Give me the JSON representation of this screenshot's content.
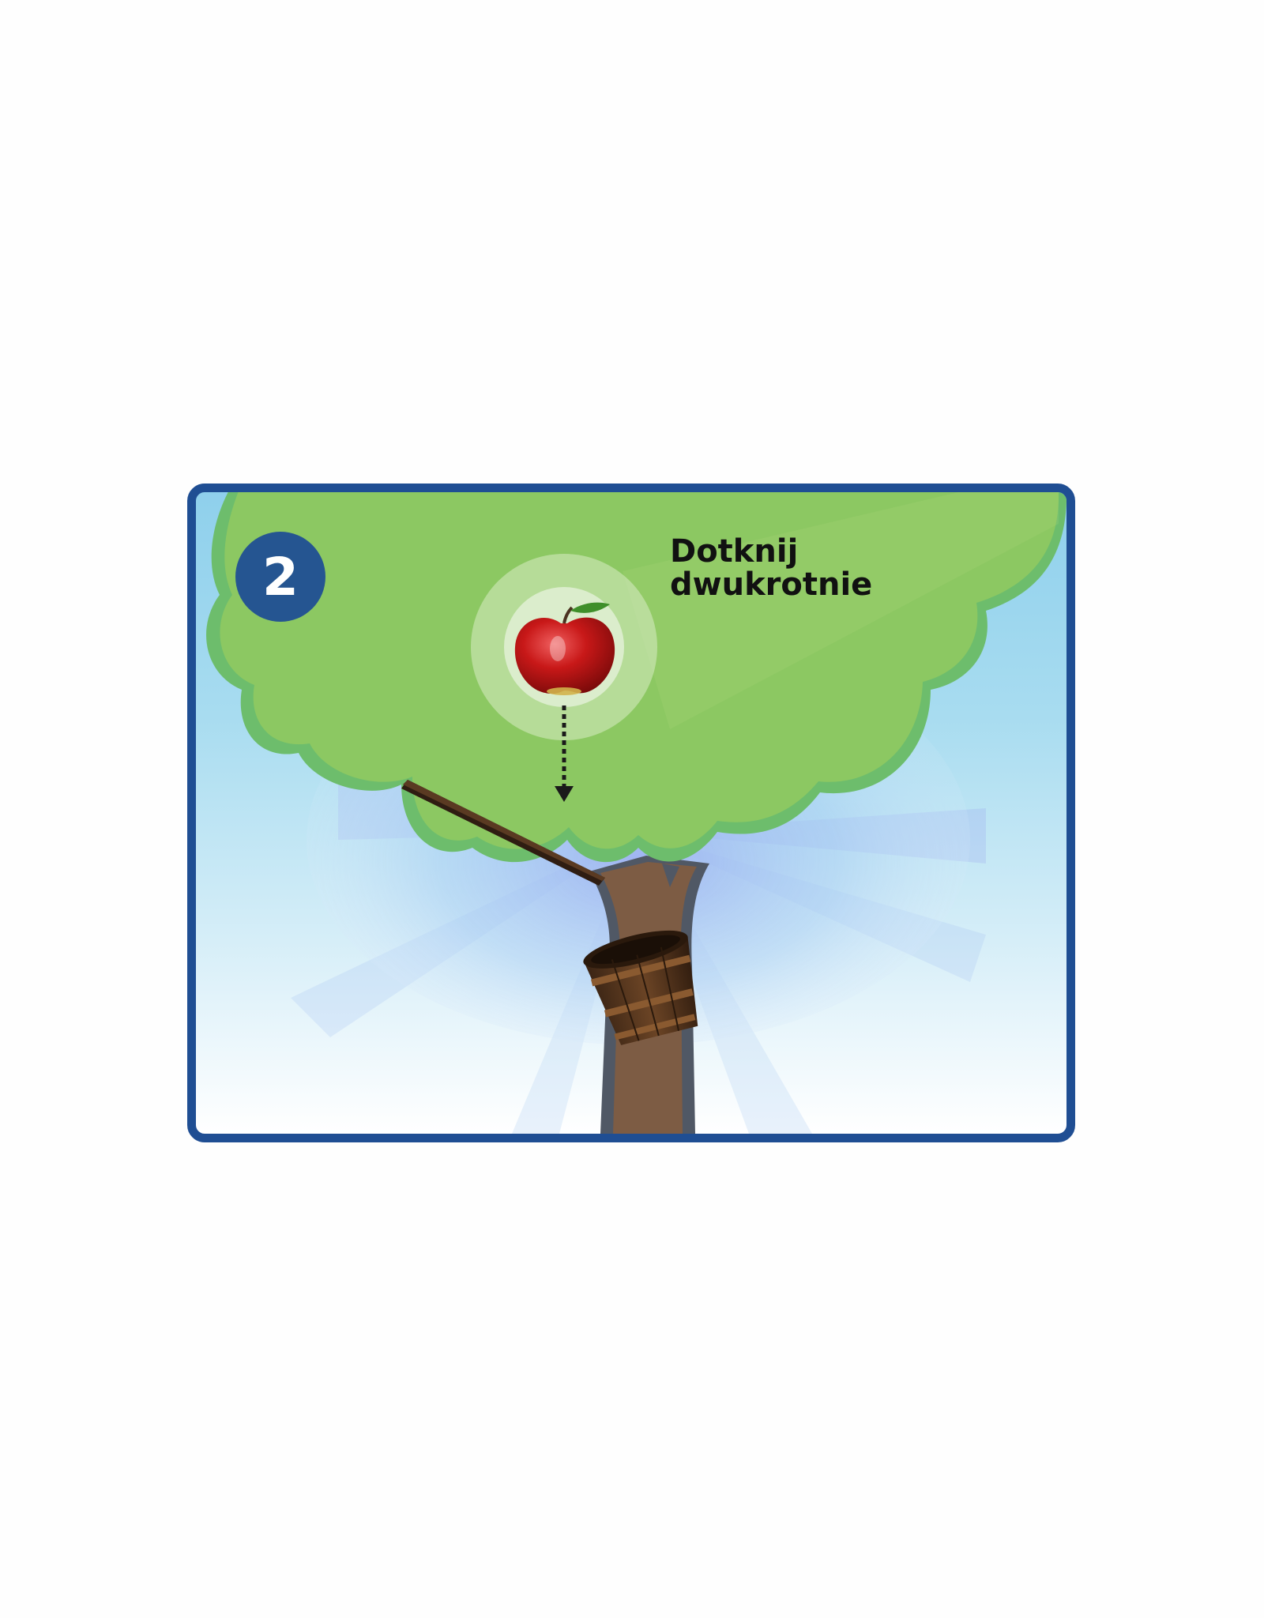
{
  "step": {
    "number": "2"
  },
  "instruction": {
    "line1": "Dotknij",
    "line2": "dwukrotnie"
  },
  "scene": {
    "target_object": "apple",
    "gesture": "double-tap",
    "objects": [
      "tree-canopy",
      "tree-trunk",
      "branch",
      "wooden-bucket",
      "apple",
      "drop-arrow"
    ]
  },
  "colors": {
    "frame": "#1f4e93",
    "badge": "#255591",
    "canopy": "#8cc862",
    "canopy_outline": "#6dbd6c",
    "trunk": "#7b5a44",
    "sky_top": "#8fd0ec"
  }
}
